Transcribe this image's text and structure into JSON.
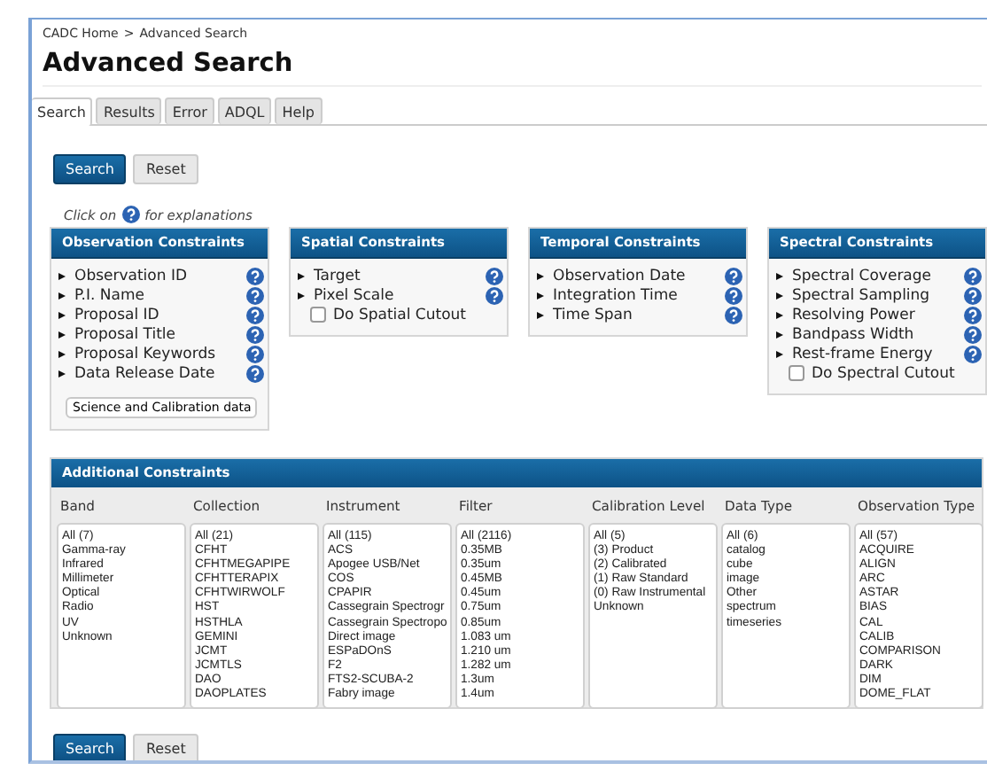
{
  "breadcrumb": {
    "home": "CADC Home",
    "separator": ">",
    "current": "Advanced Search"
  },
  "title": "Advanced Search",
  "tabs": [
    {
      "label": "Search",
      "selected": true
    },
    {
      "label": "Results",
      "selected": false
    },
    {
      "label": "Error",
      "selected": false
    },
    {
      "label": "ADQL",
      "selected": false
    },
    {
      "label": "Help",
      "selected": false
    }
  ],
  "buttons": [
    "Search",
    "Reset"
  ],
  "hint": {
    "before": "Click on",
    "after": "for explanations"
  },
  "panels": [
    {
      "title": "Observation Constraints",
      "items": [
        {
          "kind": "expander",
          "label": "Observation ID"
        },
        {
          "kind": "expander",
          "label": "P.I. Name"
        },
        {
          "kind": "expander",
          "label": "Proposal ID"
        },
        {
          "kind": "expander",
          "label": "Proposal Title"
        },
        {
          "kind": "expander",
          "label": "Proposal Keywords"
        },
        {
          "kind": "expander",
          "label": "Data Release Date"
        }
      ],
      "select": "Science and Calibration data"
    },
    {
      "title": "Spatial Constraints",
      "items": [
        {
          "kind": "expander",
          "label": "Target"
        },
        {
          "kind": "expander",
          "label": "Pixel Scale"
        },
        {
          "kind": "checkbox",
          "label": "Do Spatial Cutout",
          "checked": false
        }
      ]
    },
    {
      "title": "Temporal Constraints",
      "items": [
        {
          "kind": "expander",
          "label": "Observation Date"
        },
        {
          "kind": "expander",
          "label": "Integration Time"
        },
        {
          "kind": "expander",
          "label": "Time Span"
        }
      ]
    },
    {
      "title": "Spectral Constraints",
      "items": [
        {
          "kind": "expander",
          "label": "Spectral Coverage"
        },
        {
          "kind": "expander",
          "label": "Spectral Sampling"
        },
        {
          "kind": "expander",
          "label": "Resolving Power"
        },
        {
          "kind": "expander",
          "label": "Bandpass Width"
        },
        {
          "kind": "expander",
          "label": "Rest-frame Energy"
        },
        {
          "kind": "checkbox",
          "label": "Do Spectral Cutout",
          "checked": false
        }
      ]
    }
  ],
  "additional": {
    "title": "Additional Constraints",
    "columns": [
      {
        "heading": "Band",
        "options": [
          "All (7)",
          "Gamma-ray",
          "Infrared",
          "Millimeter",
          "Optical",
          "Radio",
          "UV",
          "Unknown"
        ]
      },
      {
        "heading": "Collection",
        "options": [
          "All (21)",
          "CFHT",
          "CFHTMEGAPIPE",
          "CFHTTERAPIX",
          "CFHTWIRWOLF",
          "HST",
          "HSTHLA",
          "GEMINI",
          "JCMT",
          "JCMTLS",
          "DAO",
          "DAOPLATES"
        ]
      },
      {
        "heading": "Instrument",
        "options": [
          "All (115)",
          "ACS",
          "Apogee USB/Net",
          "COS",
          "CPAPIR",
          "Cassegrain Spectrogr",
          "Cassegrain Spectropo",
          "Direct image",
          "ESPaDOnS",
          "F2",
          "FTS2-SCUBA-2",
          "Fabry image"
        ]
      },
      {
        "heading": "Filter",
        "options": [
          "All (2116)",
          "0.35MB",
          "0.35um",
          "0.45MB",
          "0.45um",
          "0.75um",
          "0.85um",
          "1.083 um",
          "1.210 um",
          "1.282 um",
          "1.3um",
          "1.4um"
        ]
      },
      {
        "heading": "Calibration Level",
        "options": [
          "All (5)",
          "(3) Product",
          "(2) Calibrated",
          "(1) Raw Standard",
          "(0) Raw Instrumental",
          "Unknown"
        ]
      },
      {
        "heading": "Data Type",
        "options": [
          "All (6)",
          "catalog",
          "cube",
          "image",
          "Other",
          "spectrum",
          "timeseries"
        ]
      },
      {
        "heading": "Observation Type",
        "options": [
          "All (57)",
          "ACQUIRE",
          "ALIGN",
          "ARC",
          "ASTAR",
          "BIAS",
          "CAL",
          "CALIB",
          "COMPARISON",
          "DARK",
          "DIM",
          "DOME_FLAT"
        ]
      }
    ]
  },
  "bottom_buttons": [
    "Search",
    "Reset"
  ]
}
